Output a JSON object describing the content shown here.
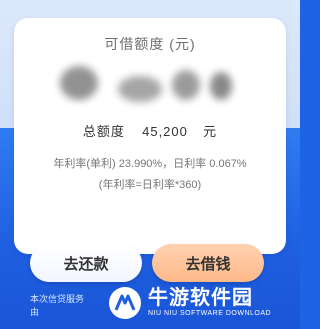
{
  "credit": {
    "title": "可借额度 (元)",
    "total_label": "总额度",
    "total_value": "45,200",
    "total_unit": "元"
  },
  "rates": {
    "annual_label": "年利率(单利)",
    "annual_value": "23.990%",
    "separator": "，",
    "daily_label": "日利率",
    "daily_value": "0.067%",
    "note": "(年利率=日利率*360)"
  },
  "actions": {
    "repay_label": "去还款",
    "borrow_label": "去借钱"
  },
  "footer": {
    "service_line1": "本次信贷服务",
    "service_line2": "由"
  },
  "watermark": {
    "cn": "牛游软件园",
    "en": "NIU NIU SOFTWARE DOWNLOAD"
  }
}
